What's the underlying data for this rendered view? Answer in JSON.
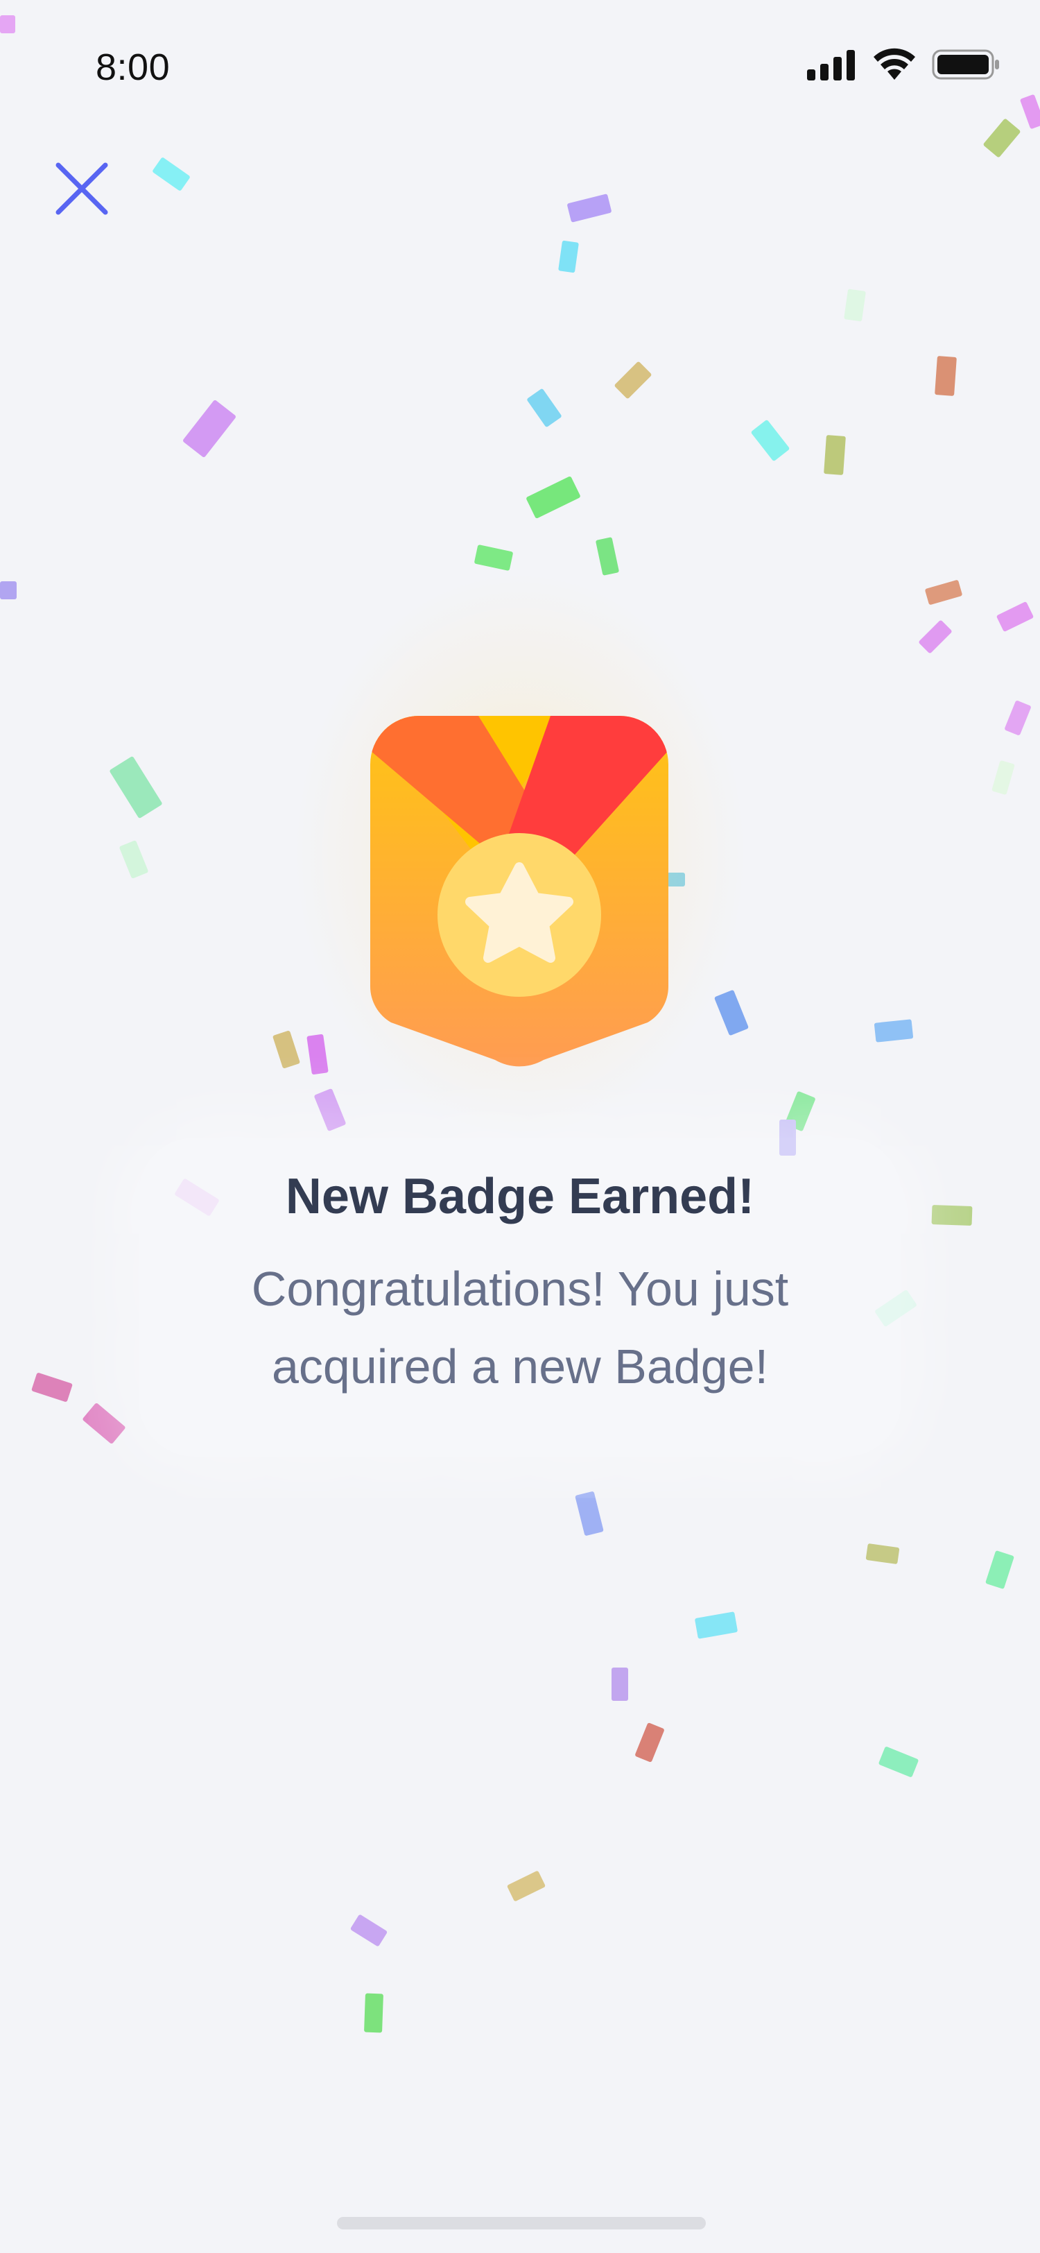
{
  "status_bar": {
    "time": "8:00"
  },
  "icons": {
    "close": "close-icon",
    "signal": "cellular-signal-icon",
    "wifi": "wifi-icon",
    "battery": "battery-icon",
    "badge": "medal-badge-icon",
    "star": "star-icon"
  },
  "colors": {
    "background": "#f3f4f8",
    "close_icon": "#5865f2",
    "title": "#333c52",
    "subtitle": "#67708a",
    "ribbon_left": "#ff6f30",
    "ribbon_right": "#ff3d3d",
    "ribbon_middle": "#ffc400",
    "shield_top": "#ffbf1f",
    "shield_bottom": "#ff9c4f",
    "medal": "#ffd86a",
    "star": "#fff2d6"
  },
  "message": {
    "title": "New Badge Earned!",
    "line1": "Congratulations! You just",
    "line2": "acquired a new Badge!"
  }
}
